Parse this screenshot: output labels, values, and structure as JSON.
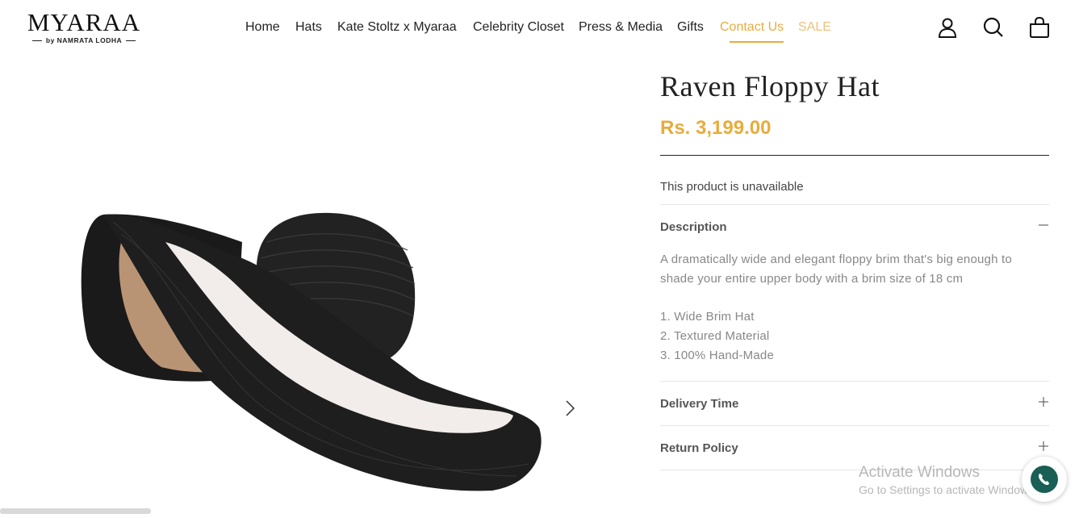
{
  "brand": {
    "name": "MYARAA",
    "tagline": "by NAMRATA LODHA"
  },
  "nav": {
    "items": [
      "Home",
      "Hats",
      "Kate Stoltz x Myaraa",
      "Celebrity Closet",
      "Press & Media",
      "Gifts",
      "Contact Us",
      "SALE"
    ],
    "active": "Contact Us",
    "accent_color": "#e8ac3c"
  },
  "header_icons": [
    "account-icon",
    "search-icon",
    "cart-bag-icon"
  ],
  "product": {
    "title": "Raven Floppy Hat",
    "price": "Rs. 3,199.00",
    "availability": "This product is unavailable",
    "description": {
      "label": "Description",
      "text": "A dramatically wide and elegant floppy brim that's big enough to shade your entire upper body with a brim size of 18 cm",
      "features": [
        "1. Wide Brim Hat",
        "2. Textured Material",
        "3. 100% Hand-Made"
      ]
    },
    "delivery_label": "Delivery Time",
    "return_label": "Return Policy"
  },
  "watermark": {
    "line1": "Activate Windows",
    "line2": "Go to Settings to activate Windows."
  },
  "colors": {
    "price": "#e8ac3c",
    "sale": "#f0c07a",
    "whatsapp": "#1a5f56"
  }
}
